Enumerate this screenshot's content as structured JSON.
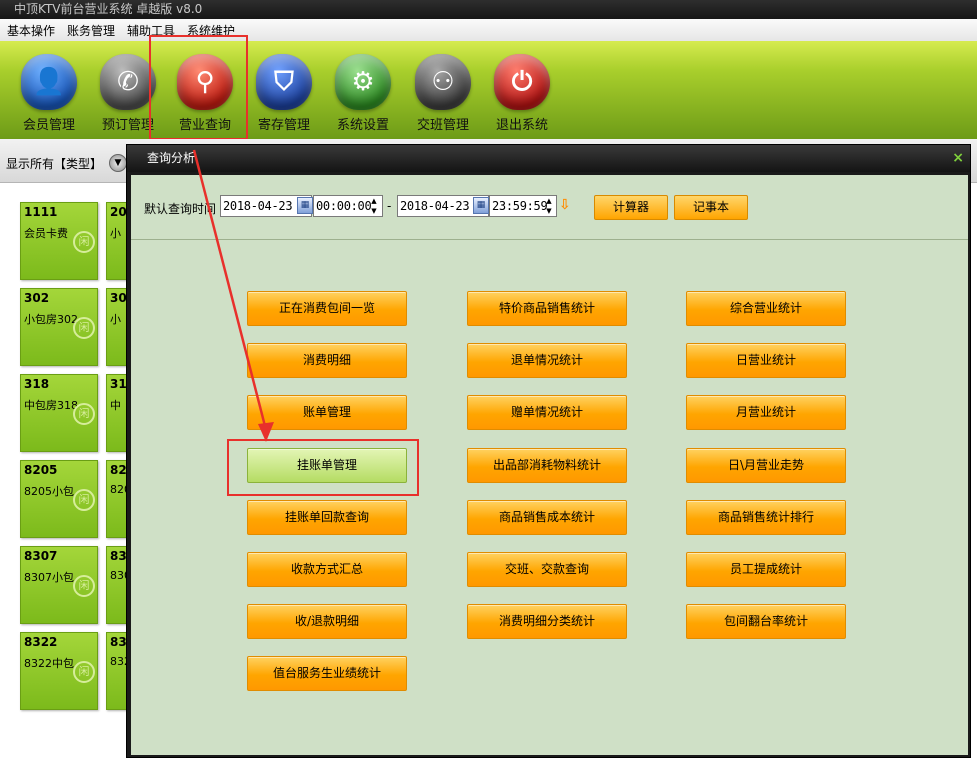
{
  "app": {
    "title": "中顶KTV前台营业系统 卓越版 v8.0"
  },
  "menu": [
    "基本操作",
    "账务管理",
    "辅助工具",
    "系统维护"
  ],
  "toolbar": [
    {
      "label": "会员管理",
      "icon": "member-icon",
      "glyph": "👤"
    },
    {
      "label": "预订管理",
      "icon": "phone-icon",
      "glyph": "✆"
    },
    {
      "label": "营业查询",
      "icon": "magnifier-icon",
      "glyph": "⚲"
    },
    {
      "label": "寄存管理",
      "icon": "bag-icon",
      "glyph": "⛉"
    },
    {
      "label": "系统设置",
      "icon": "gear-icon",
      "glyph": "⚙"
    },
    {
      "label": "交班管理",
      "icon": "people-icon",
      "glyph": "⚇"
    },
    {
      "label": "退出系统",
      "icon": "power-icon",
      "glyph": "⏻"
    }
  ],
  "filter": {
    "label": "显示所有【类型】"
  },
  "rooms": [
    {
      "num": "1111",
      "name": "会员卡费"
    },
    {
      "num": "20",
      "name": "小"
    },
    {
      "num": "302",
      "name": "小包房302"
    },
    {
      "num": "30",
      "name": "小"
    },
    {
      "num": "318",
      "name": "中包房318"
    },
    {
      "num": "31",
      "name": "中"
    },
    {
      "num": "8205",
      "name": "8205小包"
    },
    {
      "num": "82",
      "name": "820"
    },
    {
      "num": "8307",
      "name": "8307小包"
    },
    {
      "num": "83",
      "name": "830"
    },
    {
      "num": "8322",
      "name": "8322中包"
    },
    {
      "num": "83",
      "name": "832"
    }
  ],
  "dialog": {
    "title": "查询分析",
    "close": "×",
    "query_label": "默认查询时间",
    "date_from": "2018-04-23",
    "time_from": "00:00:00",
    "dash": "-",
    "date_to": "2018-04-23",
    "time_to": "23:59:59",
    "calculator": "计算器",
    "notepad": "记事本",
    "col1": [
      "正在消费包间一览",
      "消费明细",
      "账单管理",
      "挂账单管理",
      "挂账单回款查询",
      "收款方式汇总",
      "收/退款明细",
      "值台服务生业绩统计"
    ],
    "col2": [
      "特价商品销售统计",
      "退单情况统计",
      "赠单情况统计",
      "出品部消耗物料统计",
      "商品销售成本统计",
      "交班、交款查询",
      "消费明细分类统计"
    ],
    "col3": [
      "综合营业统计",
      "日营业统计",
      "月营业统计",
      "日\\月营业走势",
      "商品销售统计排行",
      "员工提成统计",
      "包间翻台率统计"
    ]
  },
  "colors": {
    "accent_red": "#e8302b",
    "button_orange": "#ffa500",
    "dialog_bg": "#cfe0c6",
    "tile_green": "#8cc629"
  }
}
